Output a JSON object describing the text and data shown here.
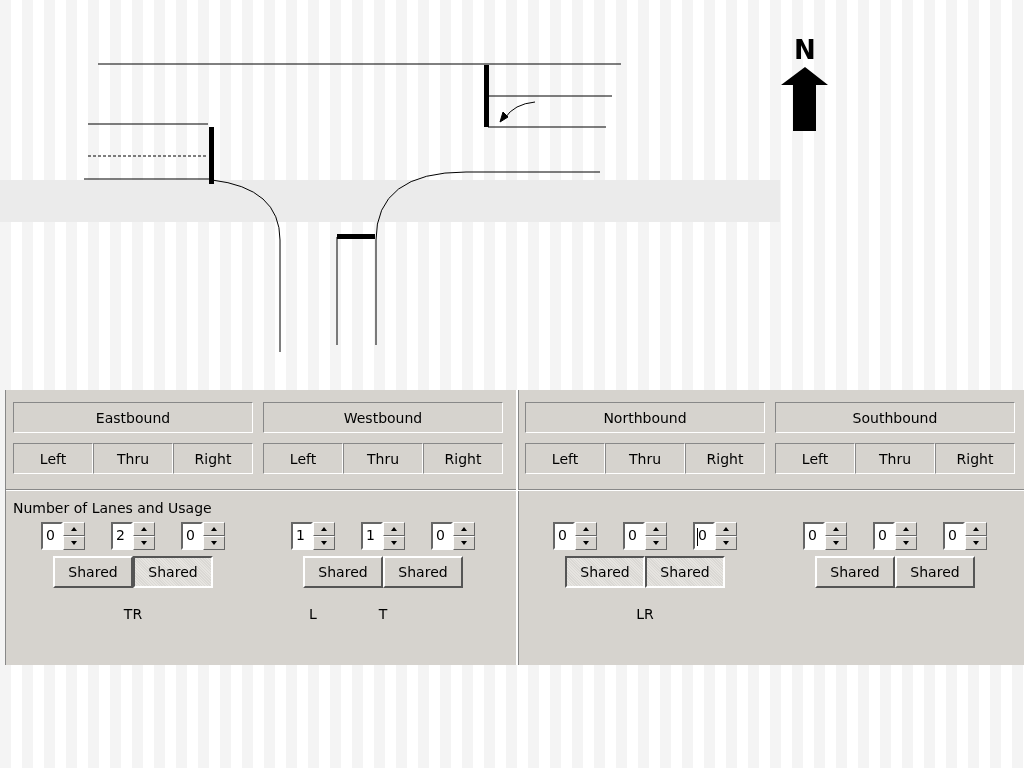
{
  "diagram": {
    "north_label": "N"
  },
  "approaches": [
    {
      "name": "Eastbound",
      "movements": [
        "Left",
        "Thru",
        "Right"
      ],
      "lanes": [
        {
          "value": "0",
          "focused": false
        },
        {
          "value": "2",
          "focused": false,
          "usage": "TR"
        },
        {
          "value": "0",
          "focused": false
        }
      ],
      "shared": [
        {
          "label": "Shared",
          "pressed": false
        },
        {
          "label": "Shared",
          "pressed": true
        }
      ]
    },
    {
      "name": "Westbound",
      "movements": [
        "Left",
        "Thru",
        "Right"
      ],
      "lanes": [
        {
          "value": "1",
          "focused": false,
          "usage": "L"
        },
        {
          "value": "1",
          "focused": false,
          "usage": "T"
        },
        {
          "value": "0",
          "focused": false
        }
      ],
      "shared": [
        {
          "label": "Shared",
          "pressed": false
        },
        {
          "label": "Shared",
          "pressed": false
        }
      ]
    },
    {
      "name": "Northbound",
      "movements": [
        "Left",
        "Thru",
        "Right"
      ],
      "lanes": [
        {
          "value": "0",
          "focused": false
        },
        {
          "value": "0",
          "focused": false,
          "usage": "LR"
        },
        {
          "value": "0",
          "focused": true
        }
      ],
      "shared": [
        {
          "label": "Shared",
          "pressed": true
        },
        {
          "label": "Shared",
          "pressed": true
        }
      ]
    },
    {
      "name": "Southbound",
      "movements": [
        "Left",
        "Thru",
        "Right"
      ],
      "lanes": [
        {
          "value": "0",
          "focused": false
        },
        {
          "value": "0",
          "focused": false
        },
        {
          "value": "0",
          "focused": false
        }
      ],
      "shared": [
        {
          "label": "Shared",
          "pressed": false
        },
        {
          "label": "Shared",
          "pressed": false
        }
      ]
    }
  ],
  "section_label": "Number of Lanes and Usage"
}
